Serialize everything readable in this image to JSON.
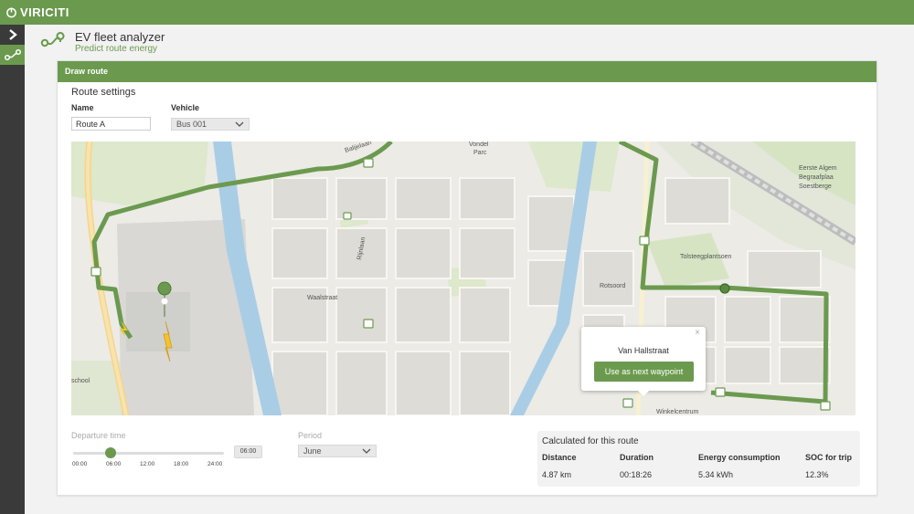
{
  "brand": {
    "logo_text": "VIRICITI",
    "accent": "#6b9a4f",
    "sidebar_bg": "#3a3a3a"
  },
  "sidebar": {
    "items": [
      {
        "icon": "chevron-right-icon"
      },
      {
        "icon": "route-icon"
      }
    ]
  },
  "header": {
    "title": "EV fleet analyzer",
    "subtitle": "Predict route energy",
    "icon": "route-icon"
  },
  "card": {
    "title": "Draw route",
    "section_title": "Route settings",
    "name_label": "Name",
    "name_value": "Route A",
    "vehicle_label": "Vehicle",
    "vehicle_value": "Bus 001"
  },
  "map": {
    "labels": [
      "Vondel Parc",
      "Eerste Algem",
      "Begraafplaa",
      "Soestberge",
      "Tolsteegplantsoen",
      "Winkelcentrum",
      "Rotsoord",
      "school",
      "Balijelaan",
      "Waalstraat",
      "Rijnlaan"
    ],
    "popup": {
      "title": "Van Hallstraat",
      "button": "Use as next waypoint",
      "close": "×"
    }
  },
  "controls": {
    "departure_label": "Departure time",
    "time_ticks": [
      "00:00",
      "06:00",
      "12:00",
      "18:00",
      "24:00"
    ],
    "departure_value": "06:00",
    "departure_fraction": 0.25,
    "period_label": "Period",
    "period_value": "June"
  },
  "results": {
    "title": "Calculated for this route",
    "columns": [
      {
        "label": "Distance",
        "value": "4.87 km"
      },
      {
        "label": "Duration",
        "value": "00:18:26"
      },
      {
        "label": "Energy consumption",
        "value": "5.34 kWh"
      },
      {
        "label": "SOC for trip",
        "value": "12.3%"
      }
    ]
  }
}
